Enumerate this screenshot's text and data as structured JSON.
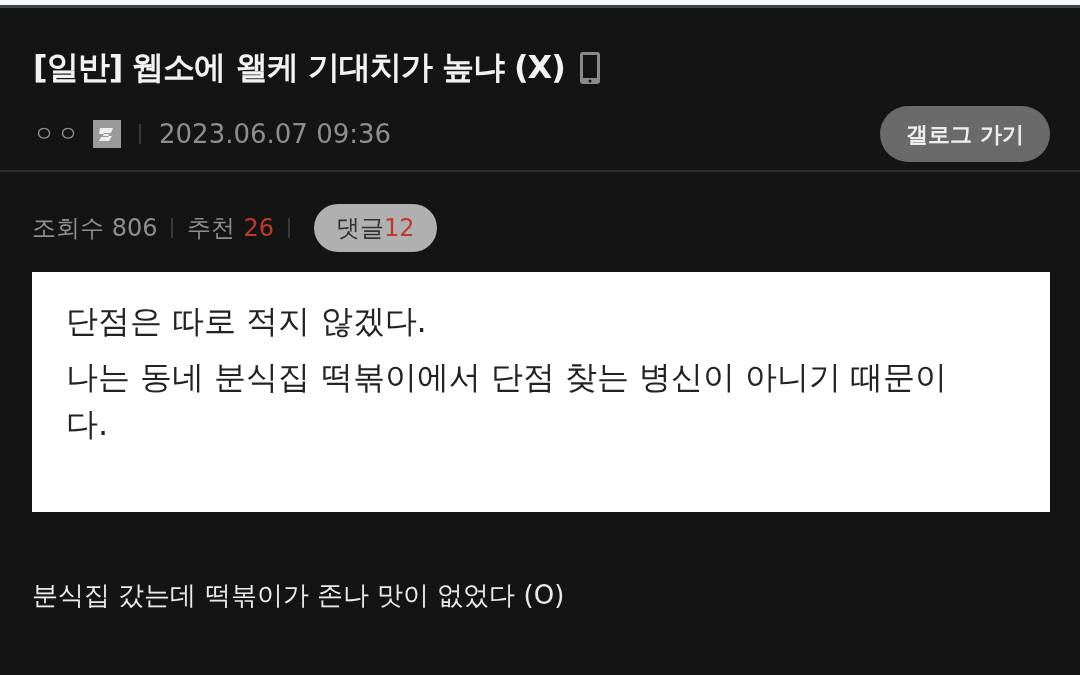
{
  "post": {
    "category": "[일반]",
    "title": "웹소에 왤케 기대치가 높냐 (X)",
    "author": "ㅇㅇ",
    "date": "2023.06.07 09:36",
    "gallery_button": "갤로그 가기"
  },
  "stats": {
    "views_label": "조회수",
    "views": "806",
    "likes_label": "추천",
    "likes": "26",
    "comments_label": "댓글",
    "comments": "12"
  },
  "quote_image": {
    "lines": [
      "단점은 따로 적지 않겠다.",
      "나는 동네 분식집 떡볶이에서 단점 찾는 병신이 아니기 때문이다."
    ]
  },
  "body": [
    "분식집 갔는데 떡볶이가 존나 맛이 없었다 (O)"
  ]
}
